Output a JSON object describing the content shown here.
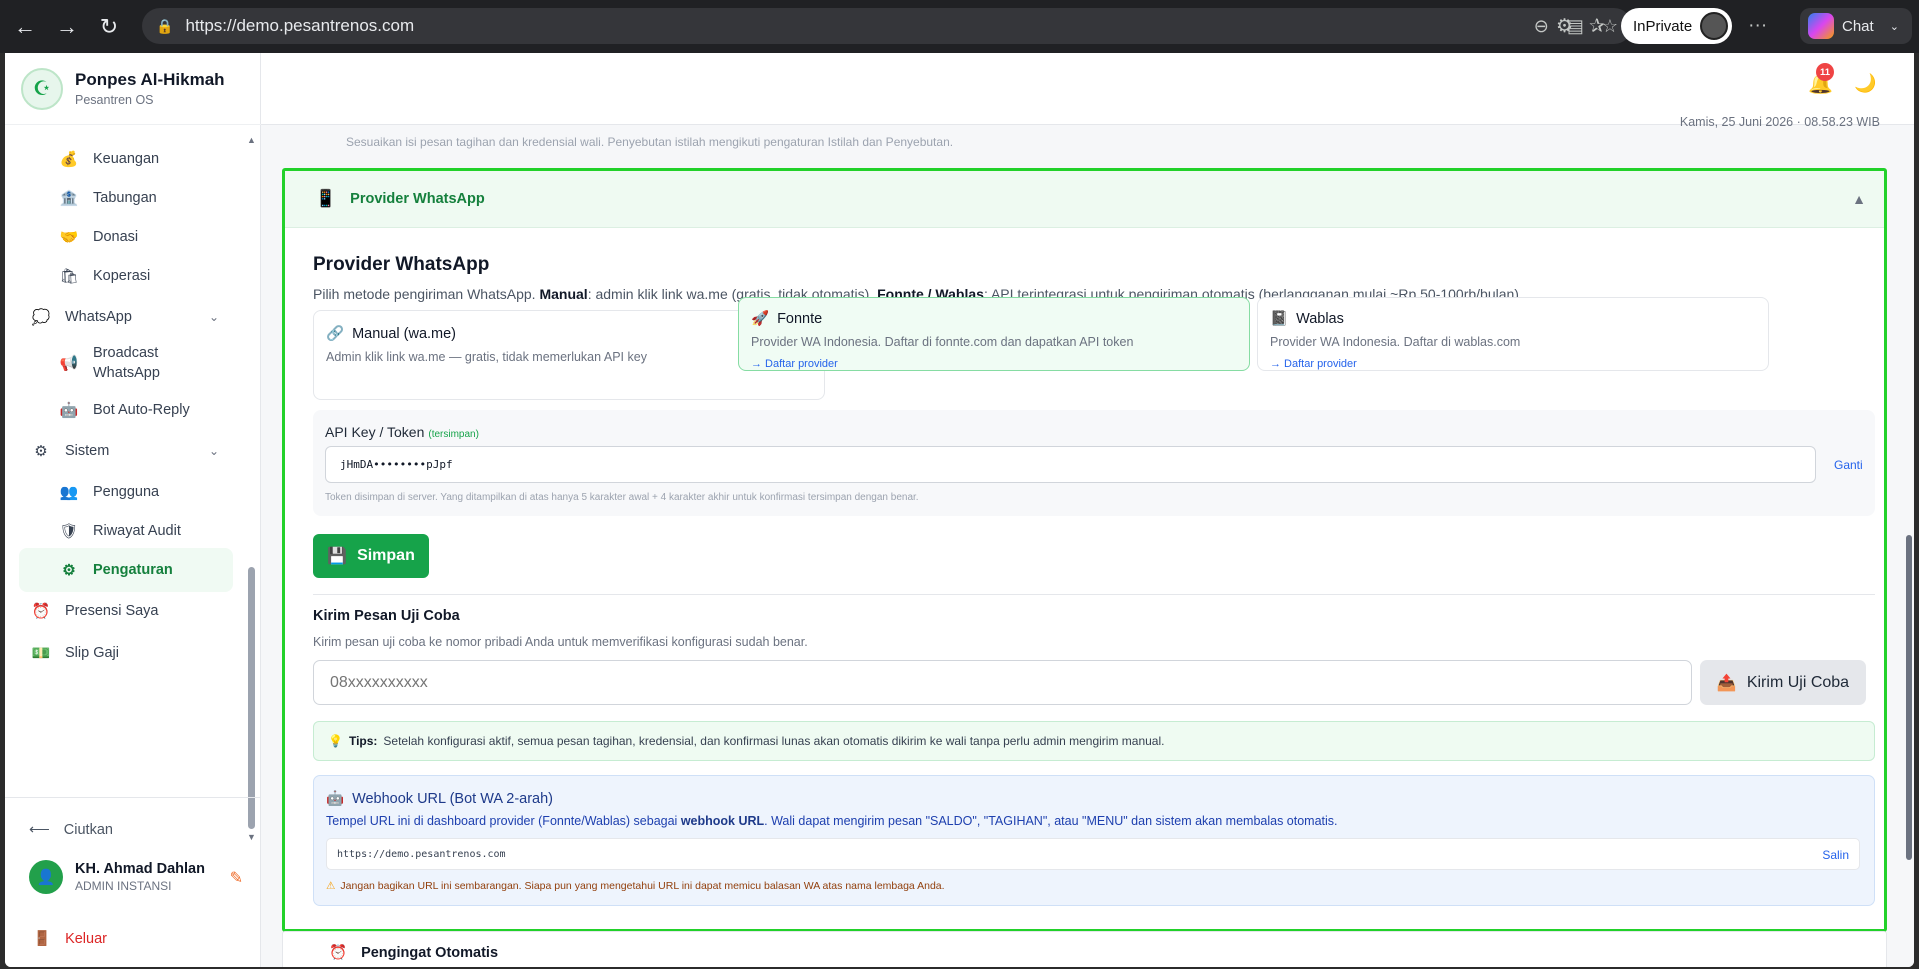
{
  "browser": {
    "url": "https://demo.pesantrenos.com",
    "inprivate_label": "InPrivate",
    "chat_label": "Chat"
  },
  "sidebar": {
    "brand_name": "Ponpes Al-Hikmah",
    "brand_sub": "Pesantren OS",
    "items": [
      {
        "label": "Keuangan",
        "icon": "money-bag-icon"
      },
      {
        "label": "Tabungan",
        "icon": "bank-icon"
      },
      {
        "label": "Donasi",
        "icon": "handshake-icon"
      },
      {
        "label": "Koperasi",
        "icon": "shopping-bag-icon"
      },
      {
        "label": "WhatsApp",
        "icon": "chat-bubble-icon"
      },
      {
        "label": "Broadcast\nWhatsApp",
        "icon": "megaphone-icon"
      },
      {
        "label": "Bot Auto-Reply",
        "icon": "robot-icon"
      },
      {
        "label": "Sistem",
        "icon": "gear-icon"
      },
      {
        "label": "Pengguna",
        "icon": "users-icon"
      },
      {
        "label": "Riwayat Audit",
        "icon": "shield-icon"
      },
      {
        "label": "Pengaturan",
        "icon": "gear-icon"
      },
      {
        "label": "Presensi Saya",
        "icon": "alarm-clock-icon"
      },
      {
        "label": "Slip Gaji",
        "icon": "cash-icon"
      }
    ],
    "collapse_label": "Ciutkan",
    "user_name": "KH. Ahmad Dahlan",
    "user_role": "ADMIN INSTANSI",
    "logout_label": "Keluar"
  },
  "topbar": {
    "notification_count": "11",
    "datetime": "Kamis, 25 Juni 2026 · 08.58.23 WIB"
  },
  "cut_text": "Sesuaikan isi pesan tagihan dan kredensial wali. Penyebutan istilah mengikuti pengaturan Istilah dan Penyebutan.",
  "section": {
    "header_title": "Provider WhatsApp",
    "title": "Provider WhatsApp",
    "desc_pre": "Pilih metode pengiriman WhatsApp. ",
    "desc_manual_b": "Manual",
    "desc_mid": ": admin klik link wa.me (gratis, tidak otomatis). ",
    "desc_api_b": "Fonnte / Wablas",
    "desc_post": ": API terintegrasi untuk pengiriman otomatis (berlangganan mulai ~Rp 50-100rb/bulan).",
    "providers": [
      {
        "name": "Manual (wa.me)",
        "desc": "Admin klik link wa.me — gratis, tidak memerlukan API key",
        "link": "",
        "selected": false
      },
      {
        "name": "Fonnte",
        "desc": "Provider WA Indonesia. Daftar di fonnte.com dan dapatkan API token",
        "link": "→ Daftar provider",
        "selected": true
      },
      {
        "name": "Wablas",
        "desc": "Provider WA Indonesia. Daftar di wablas.com",
        "link": "→ Daftar provider",
        "selected": false
      }
    ],
    "api_label": "API Key / Token",
    "api_saved": "(tersimpan)",
    "api_value": "jHmDA••••••••pJpf",
    "api_change": "Ganti",
    "api_hint": "Token disimpan di server. Yang ditampilkan di atas hanya 5 karakter awal + 4 karakter akhir untuk konfirmasi tersimpan dengan benar.",
    "save_label": "Simpan",
    "test_title": "Kirim Pesan Uji Coba",
    "test_desc": "Kirim pesan uji coba ke nomor pribadi Anda untuk memverifikasi konfigurasi sudah benar.",
    "phone_placeholder": "08xxxxxxxxxx",
    "test_button": "Kirim Uji Coba",
    "tips_b": "Tips:",
    "tips_text": "Setelah konfigurasi aktif, semua pesan tagihan, kredensial, dan konfirmasi lunas akan otomatis dikirim ke wali tanpa perlu admin mengirim manual.",
    "webhook_title": "Webhook URL (Bot WA 2-arah)",
    "webhook_desc_pre": "Tempel URL ini di dashboard provider (Fonnte/Wablas) sebagai ",
    "webhook_desc_b": "webhook URL",
    "webhook_desc_post": ". Wali dapat mengirim pesan \"SALDO\", \"TAGIHAN\", atau \"MENU\" dan sistem akan membalas otomatis.",
    "webhook_url": "https://demo.pesantrenos.com",
    "webhook_copy": "Salin",
    "webhook_warn": "Jangan bagikan URL ini sembarangan. Siapa pun yang mengetahui URL ini dapat memicu balasan WA atas nama lembaga Anda."
  },
  "next_section_title": "Pengingat Otomatis",
  "colors": {
    "accent": "#16a34a",
    "highlight_border": "#22d12a",
    "danger": "#dc2626",
    "link": "#2563eb"
  }
}
